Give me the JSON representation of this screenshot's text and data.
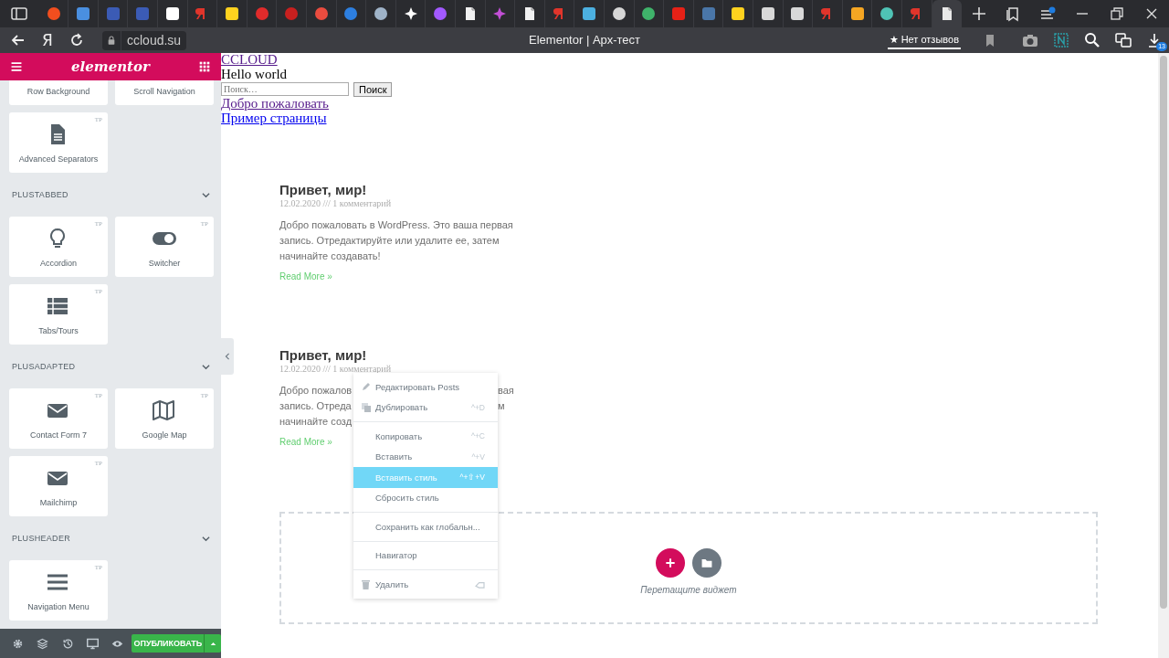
{
  "browser": {
    "tabs": [
      {
        "kind": "circle",
        "color": "#f24e1e",
        "selected": false
      },
      {
        "kind": "square",
        "color": "#4a8fe0",
        "selected": false
      },
      {
        "kind": "square",
        "color": "#3b5bb5",
        "selected": false
      },
      {
        "kind": "square",
        "color": "#3b5bb5",
        "selected": false
      },
      {
        "kind": "square",
        "color": "#ffffff",
        "selected": false
      },
      {
        "kind": "bar",
        "color": "#e0352b",
        "selected": false
      },
      {
        "kind": "square",
        "color": "#ffd21f",
        "selected": false
      },
      {
        "kind": "circle",
        "color": "#e02b2b",
        "selected": false
      },
      {
        "kind": "circle",
        "color": "#c8201f",
        "selected": false
      },
      {
        "kind": "circle",
        "color": "#ea4c3f",
        "selected": false
      },
      {
        "kind": "circle",
        "color": "#2d7fe0",
        "selected": false
      },
      {
        "kind": "circle",
        "color": "#9fb3c8",
        "selected": false
      },
      {
        "kind": "star",
        "color": "#ffffff",
        "selected": false
      },
      {
        "kind": "circle",
        "color": "#a259ff",
        "selected": false
      },
      {
        "kind": "doc",
        "color": "#f1f1f1",
        "selected": false
      },
      {
        "kind": "star",
        "color": "#c24fd6",
        "selected": false
      },
      {
        "kind": "doc",
        "color": "#f1f1f1",
        "selected": false
      },
      {
        "kind": "bar",
        "color": "#e0352b",
        "selected": false
      },
      {
        "kind": "square",
        "color": "#4cb0e0",
        "selected": false
      },
      {
        "kind": "circle",
        "color": "#d6d6d6",
        "selected": false
      },
      {
        "kind": "circle",
        "color": "#3fb36a",
        "selected": false
      },
      {
        "kind": "square",
        "color": "#e62117",
        "selected": false
      },
      {
        "kind": "square",
        "color": "#4a76a8",
        "selected": false
      },
      {
        "kind": "square",
        "color": "#ffd21f",
        "selected": false
      },
      {
        "kind": "square",
        "color": "#d8d8d8",
        "selected": false
      },
      {
        "kind": "square",
        "color": "#d8d8d8",
        "selected": false
      },
      {
        "kind": "bar",
        "color": "#e0352b",
        "selected": false
      },
      {
        "kind": "square",
        "color": "#f5a623",
        "selected": false
      },
      {
        "kind": "circle",
        "color": "#4fc3b5",
        "selected": false
      },
      {
        "kind": "bar",
        "color": "#e0352b",
        "selected": false
      },
      {
        "kind": "doc",
        "color": "#e8e8e8",
        "selected": true
      }
    ],
    "home_button": "Я",
    "address": "ccloud.su",
    "title": "Elementor | Арх-тест",
    "reviews": "★ Нет отзывов",
    "downloads_count": "13"
  },
  "panel": {
    "sections": [
      {
        "widgets": [
          {
            "kind": "cut",
            "label": "Row Background"
          },
          {
            "kind": "cut",
            "label": "Scroll Navigation"
          },
          {
            "kind": "document",
            "label": "Advanced Separators",
            "badge": "TP"
          }
        ]
      },
      {
        "title": "PLUSTABBED",
        "expanded": true,
        "widgets": [
          {
            "kind": "bulb",
            "label": "Accordion",
            "badge": "TP"
          },
          {
            "kind": "toggle",
            "label": "Switcher",
            "badge": "TP"
          },
          {
            "kind": "tabs",
            "label": "Tabs/Tours",
            "badge": "TP"
          }
        ]
      },
      {
        "title": "PLUSADAPTED",
        "expanded": true,
        "widgets": [
          {
            "kind": "mail",
            "label": "Contact Form 7",
            "badge": "TP"
          },
          {
            "kind": "map",
            "label": "Google Map",
            "badge": "TP"
          },
          {
            "kind": "mail",
            "label": "Mailchimp",
            "badge": "TP"
          }
        ]
      },
      {
        "title": "PLUSHEADER",
        "expanded": true,
        "widgets": [
          {
            "kind": "menu",
            "label": "Navigation Menu",
            "badge": "TP"
          }
        ]
      }
    ],
    "logo": "elementor",
    "publish": "ОПУБЛИКОВАТЬ"
  },
  "page": {
    "site_title": "CCLOUD",
    "tagline": "Hello world",
    "search": {
      "placeholder": "Поиск…",
      "button": "Поиск"
    },
    "nav": [
      "Добро пожаловать",
      "Пример страницы"
    ],
    "posts": [
      {
        "title": "Привет, мир!",
        "meta": "12.02.2020 /// 1 комментарий",
        "excerpt": "Добро пожаловать в WordPress. Это ваша первая запись. Отредактируйте или удалите ее, затем начинайте создавать!",
        "read_more": "Read More »"
      },
      {
        "title": "Привет, мир!",
        "meta": "12.02.2020 /// 1 комментарий",
        "excerpt_fragments": [
          {
            "left": "Добро пожалов",
            "right": "вая"
          },
          {
            "left": "запись. Отреда",
            "right": "м"
          },
          {
            "left": "начинайте созд"
          }
        ],
        "read_more": "Read More »"
      }
    ],
    "dropzone": {
      "hint": "Перетащите виджет"
    },
    "context_menu": {
      "groups": [
        [
          {
            "kind": "pencil",
            "label": "Редактировать Posts",
            "selected": false
          },
          {
            "kind": "duplicate",
            "label": "Дублировать",
            "shortcut": "^+D",
            "selected": false
          }
        ],
        [
          {
            "label": "Копировать",
            "shortcut": "^+C",
            "selected": false
          },
          {
            "label": "Вставить",
            "shortcut": "^+V",
            "selected": false
          },
          {
            "label": "Вставить стиль",
            "shortcut": "^+⇧+V",
            "selected": true
          },
          {
            "label": "Сбросить стиль",
            "selected": false
          }
        ],
        [
          {
            "label": "Сохранить как глобальн...",
            "selected": false
          }
        ],
        [
          {
            "label": "Навигатор",
            "selected": false
          }
        ],
        [
          {
            "kind": "trash",
            "label": "Удалить",
            "selected": false
          }
        ]
      ]
    }
  }
}
